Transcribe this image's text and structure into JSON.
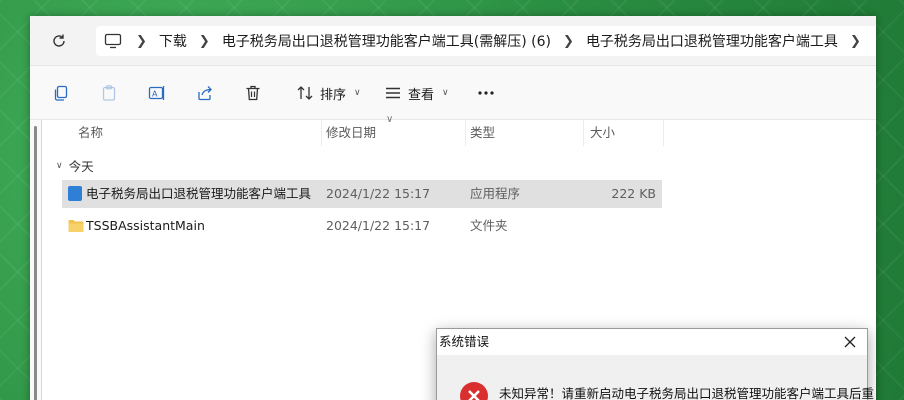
{
  "breadcrumb": {
    "items": [
      "下载",
      "电子税务局出口退税管理功能客户端工具(需解压) (6)",
      "电子税务局出口退税管理功能客户端工具"
    ],
    "icons": [
      "refresh-icon",
      "computer-icon",
      "chevron-right-icon"
    ]
  },
  "toolbar": {
    "sort_label": "排序",
    "view_label": "查看",
    "icons": [
      "copy-icon",
      "paste-icon",
      "rename-icon",
      "share-icon",
      "delete-icon",
      "sort-icon",
      "view-icon",
      "more-icon"
    ]
  },
  "columns": [
    "名称",
    "修改日期",
    "类型",
    "大小"
  ],
  "group": {
    "label": "今天"
  },
  "files": [
    {
      "name": "电子税务局出口退税管理功能客户端工具",
      "modified": "2024/1/22 15:17",
      "type": "应用程序",
      "size": "222 KB",
      "selected": true
    },
    {
      "name": "TSSBAssistantMain",
      "modified": "2024/1/22 15:17",
      "type": "文件夹",
      "size": "",
      "selected": false
    }
  ],
  "dialog": {
    "title": "系统错误",
    "message": "未知异常！请重新启动电子税务局出口退税管理功能客户端工具后重"
  },
  "colors": {
    "background": "#2f9a48",
    "selected_row": "#e0e0e0",
    "error_red": "#d92f2f",
    "app_blue": "#2f7fd6",
    "folder_yellow": "#f2c14e"
  }
}
